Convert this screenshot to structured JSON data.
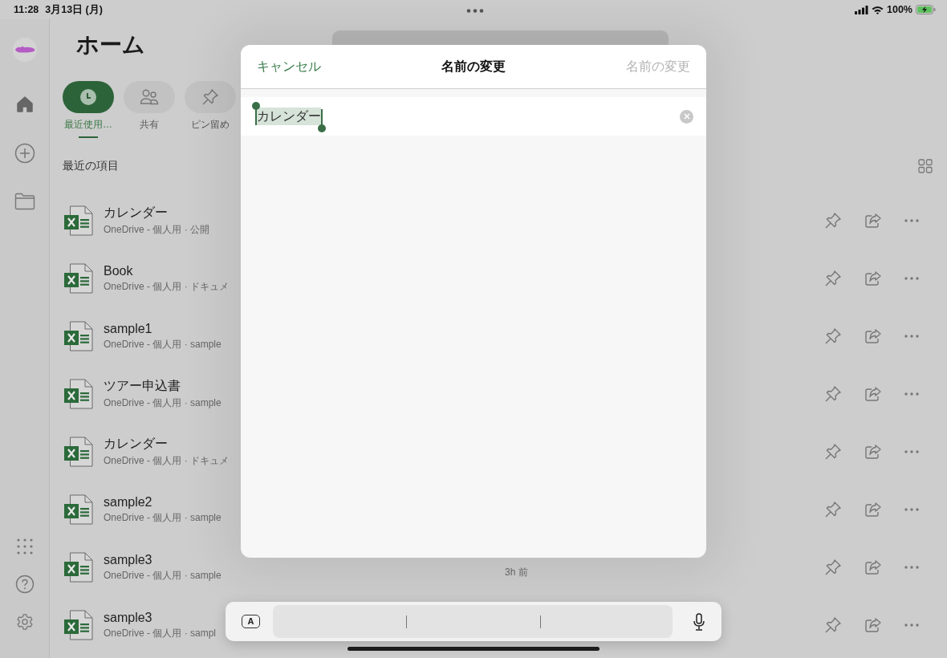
{
  "status_bar": {
    "time": "11:28",
    "date": "3月13日 (月)",
    "battery": "100%"
  },
  "header": {
    "title": "ホーム"
  },
  "tabs": [
    {
      "kind": "recent",
      "label": "最近使用…",
      "selected": true
    },
    {
      "kind": "shared",
      "label": "共有",
      "selected": false
    },
    {
      "kind": "pinned",
      "label": "ピン留め",
      "selected": false
    }
  ],
  "section_title": "最近の項目",
  "files": [
    {
      "name": "カレンダー",
      "location": "OneDrive - 個人用 · 公開"
    },
    {
      "name": "Book",
      "location": "OneDrive - 個人用 · ドキュメ"
    },
    {
      "name": "sample1",
      "location": "OneDrive - 個人用 · sample"
    },
    {
      "name": "ツアー申込書",
      "location": "OneDrive - 個人用 · sample"
    },
    {
      "name": "カレンダー",
      "location": "OneDrive - 個人用 · ドキュメ"
    },
    {
      "name": "sample2",
      "location": "OneDrive - 個人用 · sample"
    },
    {
      "name": "sample3",
      "location": "OneDrive - 個人用 · sample",
      "time": "3h 前"
    },
    {
      "name": "sample3",
      "location": "OneDrive - 個人用 · sampl"
    }
  ],
  "dialog": {
    "cancel": "キャンセル",
    "title": "名前の変更",
    "confirm": {
      "label": "名前の変更",
      "disabled": true
    },
    "field": {
      "value": "カレンダー",
      "text_selected": true
    }
  },
  "keyboard_bar": {
    "key": "A"
  }
}
